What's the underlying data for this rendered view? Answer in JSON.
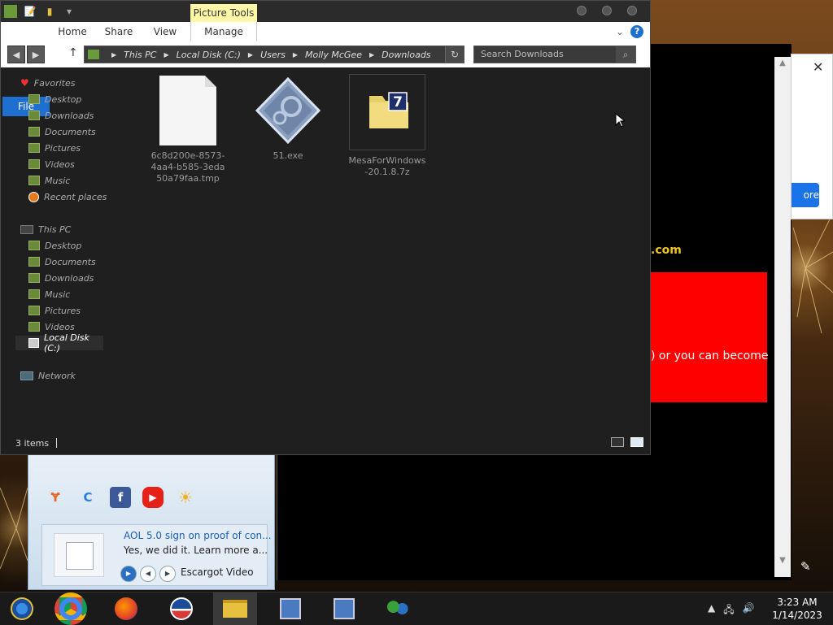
{
  "explorer": {
    "picture_tools": "Picture Tools",
    "tabs": {
      "file": "File",
      "home": "Home",
      "share": "Share",
      "view": "View",
      "manage": "Manage"
    },
    "breadcrumb": [
      "This PC",
      "Local Disk (C:)",
      "Users",
      "Molly McGee",
      "Downloads"
    ],
    "search_placeholder": "Search Downloads",
    "nav": {
      "favorites": "Favorites",
      "fav_items": [
        "Desktop",
        "Downloads",
        "Documents",
        "Pictures",
        "Videos",
        "Music",
        "Recent places"
      ],
      "this_pc": "This PC",
      "pc_items": [
        "Desktop",
        "Documents",
        "Downloads",
        "Music",
        "Pictures",
        "Videos",
        "Local Disk (C:)"
      ],
      "network": "Network"
    },
    "files": [
      {
        "name": "6c8d200e-8573-4aa4-b585-3eda50a79faa.tmp",
        "icon": "blank-file-icon"
      },
      {
        "name": "51.exe",
        "icon": "executable-icon"
      },
      {
        "name": "MesaForWindows-20.1.8.7z",
        "icon": "7z-archive-icon"
      }
    ],
    "status": "3 items"
  },
  "browser": {
    "domain_suffix": ".com",
    "red_text": ") or you can become",
    "popup_more": "ore"
  },
  "gadget": {
    "title": "AOL 5.0 sign on proof of con...",
    "subtitle": "Yes, we did it. Learn more a...",
    "media_label": "Escargot Video"
  },
  "taskbar": {
    "time": "3:23 AM",
    "date": "1/14/2023"
  },
  "colors": {
    "file_tab": "#1e6fd0",
    "picture_tools_bg": "#fff7a8",
    "explorer_bg": "#1f1f1f",
    "red_box": "#ff0000",
    "domain_text": "#f0c420"
  }
}
